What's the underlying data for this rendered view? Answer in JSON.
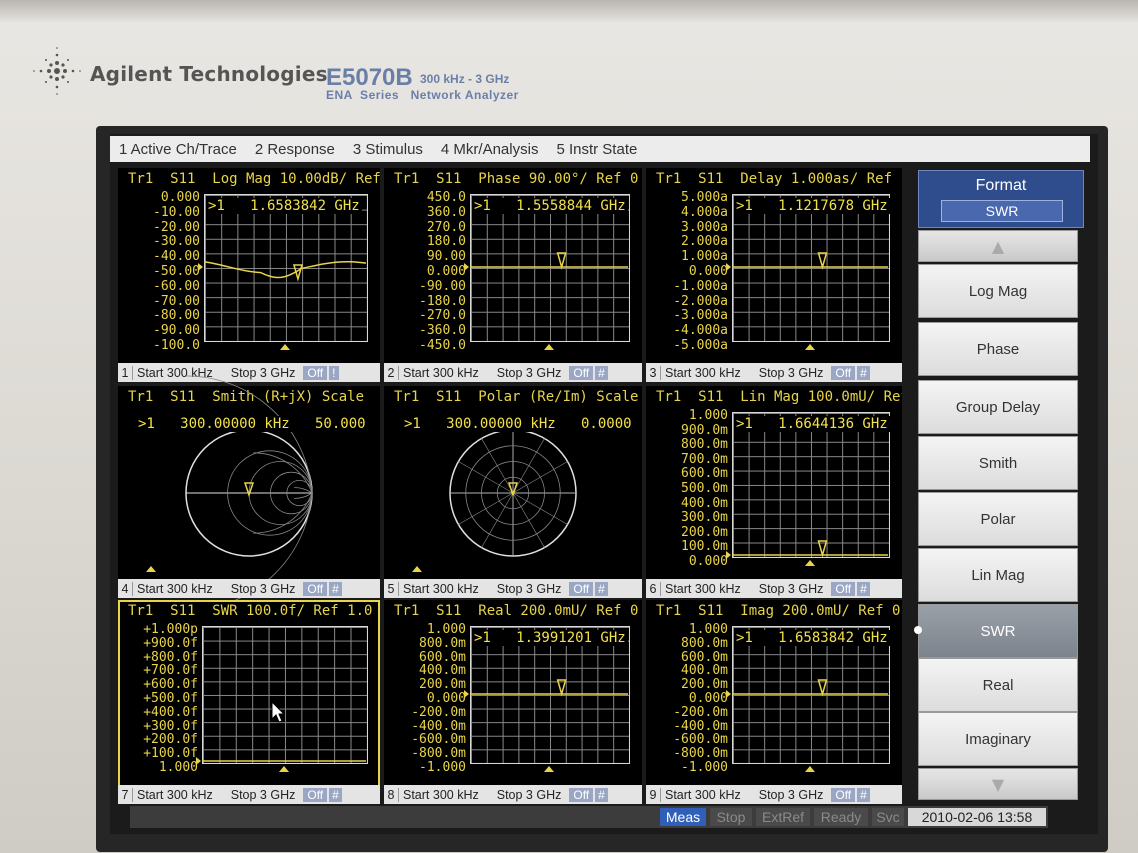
{
  "instrument": {
    "brand": "Agilent Technologies",
    "model": "E5070B",
    "freq_range": "300 kHz - 3 GHz",
    "series_line": "ENA  Series   Network Analyzer"
  },
  "menu": [
    "1 Active Ch/Trace",
    "2 Response",
    "3 Stimulus",
    "4 Mkr/Analysis",
    "5 Instr State"
  ],
  "panels": [
    {
      "num": "1",
      "title": "Tr1  S11  Log Mag 10.00dB/ Ref",
      "start": "Start 300 kHz",
      "stop": "Stop 3 GHz",
      "off": "Off",
      "hash": "!",
      "y_labels": [
        "0.000",
        "-10.00",
        "-20.00",
        "-30.00",
        "-40.00",
        "-50.00",
        "-60.00",
        "-70.00",
        "-80.00",
        "-90.00",
        "-100.0"
      ],
      "marker": ">1   1.6583842 GHz",
      "kind": "logmag"
    },
    {
      "num": "2",
      "title": "Tr1  S11  Phase 90.00°/ Ref 0",
      "start": "Start 300 kHz",
      "stop": "Stop 3 GHz",
      "off": "Off",
      "hash": "#",
      "y_labels": [
        "450.0",
        "360.0",
        "270.0",
        "180.0",
        "90.00",
        "0.000",
        "-90.00",
        "-180.0",
        "-270.0",
        "-360.0",
        "-450.0"
      ],
      "marker": ">1   1.5558844 GHz",
      "kind": "flat"
    },
    {
      "num": "3",
      "title": "Tr1  S11  Delay 1.000as/ Ref",
      "start": "Start 300 kHz",
      "stop": "Stop 3 GHz",
      "off": "Off",
      "hash": "#",
      "y_labels": [
        "5.000a",
        "4.000a",
        "3.000a",
        "2.000a",
        "1.000a",
        "0.000",
        "-1.000a",
        "-2.000a",
        "-3.000a",
        "-4.000a",
        "-5.000a"
      ],
      "marker": ">1   1.1217678 GHz",
      "kind": "flat"
    },
    {
      "num": "4",
      "title": "Tr1  S11  Smith (R+jX) Scale",
      "start": "Start 300 kHz",
      "stop": "Stop 3 GHz",
      "off": "Off",
      "hash": "#",
      "marker": ">1   300.00000 kHz   50.000",
      "kind": "smith"
    },
    {
      "num": "5",
      "title": "Tr1  S11  Polar (Re/Im) Scale",
      "start": "Start 300 kHz",
      "stop": "Stop 3 GHz",
      "off": "Off",
      "hash": "#",
      "marker": ">1   300.00000 kHz   0.0000",
      "kind": "polar"
    },
    {
      "num": "6",
      "title": "Tr1  S11  Lin Mag 100.0mU/ Ref",
      "start": "Start 300 kHz",
      "stop": "Stop 3 GHz",
      "off": "Off",
      "hash": "#",
      "y_labels": [
        "1.000",
        "900.0m",
        "800.0m",
        "700.0m",
        "600.0m",
        "500.0m",
        "400.0m",
        "300.0m",
        "200.0m",
        "100.0m",
        "0.000"
      ],
      "marker": ">1   1.6644136 GHz",
      "kind": "bottom"
    },
    {
      "num": "7",
      "title": "Tr1  S11  SWR 100.0f/ Ref 1.0",
      "start": "Start 300 kHz",
      "stop": "Stop 3 GHz",
      "off": "Off",
      "hash": "#",
      "y_labels": [
        "+1.000p",
        "+900.0f",
        "+800.0f",
        "+700.0f",
        "+600.0f",
        "+500.0f",
        "+400.0f",
        "+300.0f",
        "+200.0f",
        "+100.0f",
        "1.000"
      ],
      "marker": "",
      "kind": "swr"
    },
    {
      "num": "8",
      "title": "Tr1  S11  Real 200.0mU/ Ref 0",
      "start": "Start 300 kHz",
      "stop": "Stop 3 GHz",
      "off": "Off",
      "hash": "#",
      "y_labels": [
        "1.000",
        "800.0m",
        "600.0m",
        "400.0m",
        "200.0m",
        "0.000",
        "-200.0m",
        "-400.0m",
        "-600.0m",
        "-800.0m",
        "-1.000"
      ],
      "marker": ">1   1.3991201 GHz",
      "kind": "flat"
    },
    {
      "num": "9",
      "title": "Tr1  S11  Imag 200.0mU/ Ref 0",
      "start": "Start 300 kHz",
      "stop": "Stop 3 GHz",
      "off": "Off",
      "hash": "#",
      "y_labels": [
        "1.000",
        "800.0m",
        "600.0m",
        "400.0m",
        "200.0m",
        "0.000",
        "-200.0m",
        "-400.0m",
        "-600.0m",
        "-800.0m",
        "-1.000"
      ],
      "marker": ">1   1.6583842 GHz",
      "kind": "flat"
    }
  ],
  "softkeys": {
    "header": "Format",
    "current": "SWR",
    "items": [
      "Log Mag",
      "Phase",
      "Group Delay",
      "Smith",
      "Polar",
      "Lin Mag",
      "SWR",
      "Real",
      "Imaginary"
    ],
    "selected": "SWR"
  },
  "status": {
    "meas": "Meas",
    "stop": "Stop",
    "extref": "ExtRef",
    "ready": "Ready",
    "svc": "Svc",
    "datetime": "2010-02-06 13:58"
  },
  "colors": {
    "trace": "#e8d44a",
    "grid": "#8a8a8a",
    "meas_bg": "#2f5fb8",
    "softkey_sel": "#7d838c"
  }
}
